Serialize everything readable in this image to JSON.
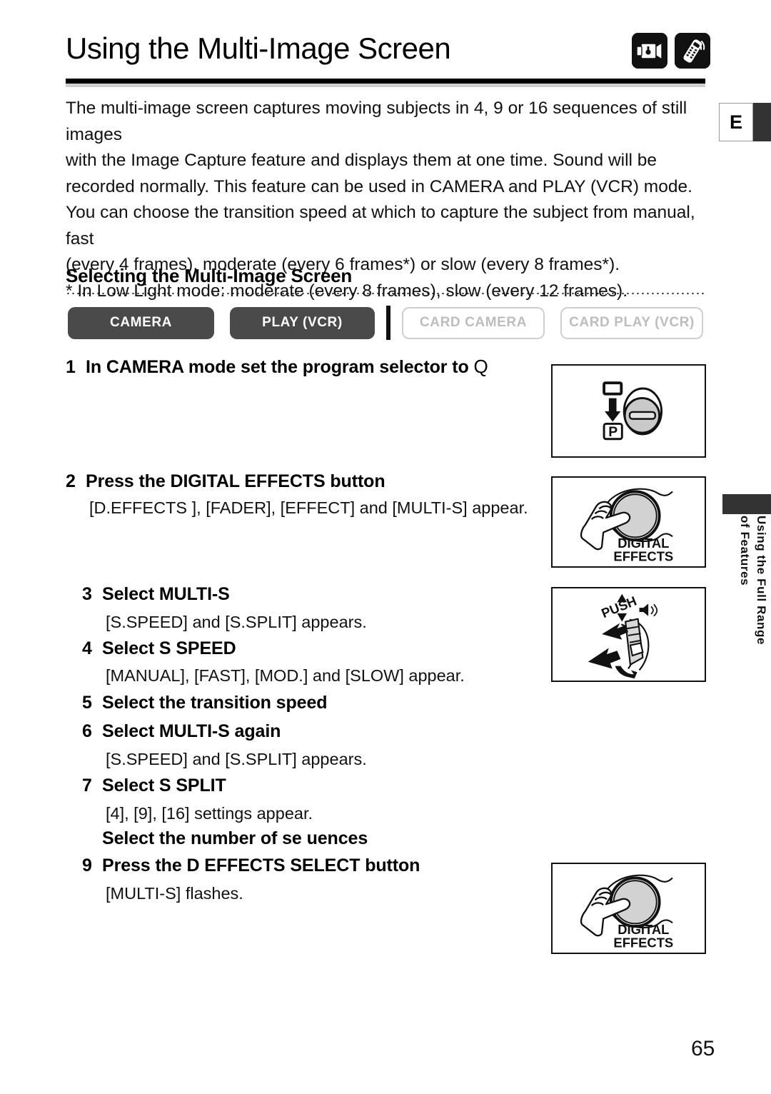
{
  "page": {
    "title": "Using the Multi-Image Screen",
    "page_number": "65",
    "language_tab": "E",
    "side_tab_line1": "Using the Full Range",
    "side_tab_line2": "of Features"
  },
  "title_icons": [
    {
      "name": "camcorder-icon"
    },
    {
      "name": "remote-control-icon"
    }
  ],
  "intro": {
    "paragraphs": [
      "The multi-image screen captures moving subjects in 4, 9 or 16 sequences of still images",
      "with the Image Capture feature and displays them at one time. Sound will be",
      "recorded normally. This feature can be used in CAMERA and PLAY (VCR) mode.",
      "You can choose the transition speed at which to capture the subject from manual, fast",
      "(every 4 frames), moderate (every 6 frames*) or slow (every 8 frames*).",
      "* In Low Light mode: moderate (every 8 frames), slow (every 12 frames)."
    ]
  },
  "section": {
    "heading": "Selecting the Multi-Image Screen"
  },
  "modes": [
    {
      "label": "CAMERA",
      "active": true
    },
    {
      "label": "PLAY (VCR)",
      "active": true
    },
    {
      "label": "CARD CAMERA",
      "active": false
    },
    {
      "label": "CARD PLAY (VCR)",
      "active": false
    }
  ],
  "steps": {
    "s1_num": "1",
    "s1_text": "In CAMERA mode  set the program selector to ",
    "s1_symbol": "Q",
    "s2_num": "2",
    "s2_text": "Press the DIGITAL EFFECTS button",
    "s2_body": "[D.EFFECTS  ], [FADER], [EFFECT] and [MULTI-S] appear.",
    "s3_num": "3",
    "s3_text": "Select  MULTI-S",
    "s3_body": "[S.SPEED] and [S.SPLIT] appears.",
    "s4_num": "4",
    "s4_text": "Select  S SPEED",
    "s4_body": "[MANUAL], [FAST], [MOD.] and [SLOW] appear.",
    "s5_num": "5",
    "s5_text": "Select the transition speed",
    "s6_num": "6",
    "s6_text": "Select  MULTI-S  again",
    "s6_body": "[S.SPEED] and [S.SPLIT] appears.",
    "s7_num": "7",
    "s7_text": "Select  S SPLIT",
    "s7_body": "[4], [9], [16] settings appear.",
    "s8_text": "Select the number of se  uences",
    "s9_num": "9",
    "s9_text": "Press the D EFFECTS SELECT button",
    "s9_body": "[MULTI-S] flashes."
  },
  "figures": {
    "dial": {
      "name": "program-selector-dial-figure",
      "label_p": "P"
    },
    "digital_effects_1": {
      "name": "digital-effects-button-figure",
      "label_line1": "DIGITAL",
      "label_line2": "EFFECTS"
    },
    "push_dial": {
      "name": "push-selector-dial-figure",
      "label": "PUSH"
    },
    "digital_effects_2": {
      "name": "digital-effects-button-figure",
      "label_line1": "DIGITAL",
      "label_line2": "EFFECTS"
    }
  },
  "colors": {
    "active_pill": "#4a4a4a",
    "inactive_pill_text": "#bdbdbd",
    "tab_dark": "#333333"
  }
}
